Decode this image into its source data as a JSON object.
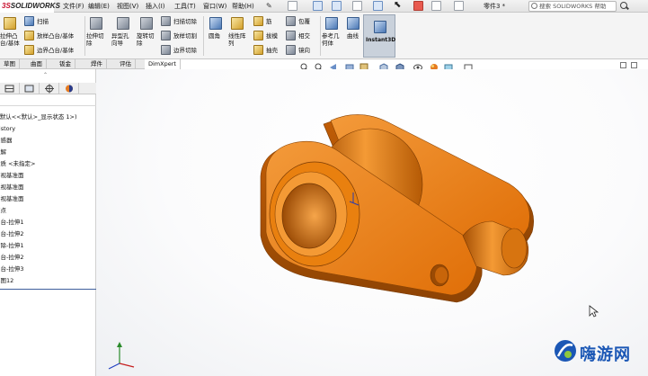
{
  "app": {
    "logo_ds": "3S",
    "logo_name": "SOLIDWORKS",
    "doc_title": "零件3 *",
    "search_placeholder": "搜索 SOLIDWORKS 帮助"
  },
  "menu": [
    "文件(F)",
    "编辑(E)",
    "视图(V)",
    "插入(I)",
    "工具(T)",
    "窗口(W)",
    "帮助(H)"
  ],
  "ribbon": {
    "boss_base": "拉伸凸台/基体",
    "sweep": "扫描",
    "loft_boss": "放样凸台/基体",
    "boundary_boss": "边界凸台/基体",
    "extruded_cut": "拉伸切除",
    "hole_wizard": "异型孔向导",
    "revolved_cut": "旋转切除",
    "swept_cut": "扫描切除",
    "lofted_cut": "放样切割",
    "boundary_cut": "边界切除",
    "fillet": "圆角",
    "linear_pattern": "线性阵列",
    "rib": "筋",
    "draft": "拔模",
    "shell": "抽壳",
    "wrap": "包覆",
    "intersect": "相交",
    "mirror": "镜向",
    "ref_geometry": "参考几何体",
    "curves": "曲线",
    "instant3d": "Instant3D"
  },
  "tabs": [
    "草图",
    "曲面",
    "钣金",
    "焊件",
    "评估",
    "DimXpert"
  ],
  "tree": {
    "header": "零件3 (默认<<默认>_显示状态 1>)",
    "items": [
      "History",
      "传感器",
      "注解",
      "材质 <未指定>",
      "前视基准面",
      "上视基准面",
      "右视基准面",
      "原点",
      "凸台-拉伸1",
      "凸台-拉伸2",
      "切除-拉伸1",
      "凸台-拉伸2",
      "凸台-拉伸3",
      "草图12"
    ]
  },
  "watermark": {
    "text": "嗨游网"
  },
  "colors": {
    "part_orange": "#e97a10",
    "part_dark": "#9a4a04",
    "selection_blue": "#3f5f9c",
    "watermark_blue": "#1b57b5"
  }
}
